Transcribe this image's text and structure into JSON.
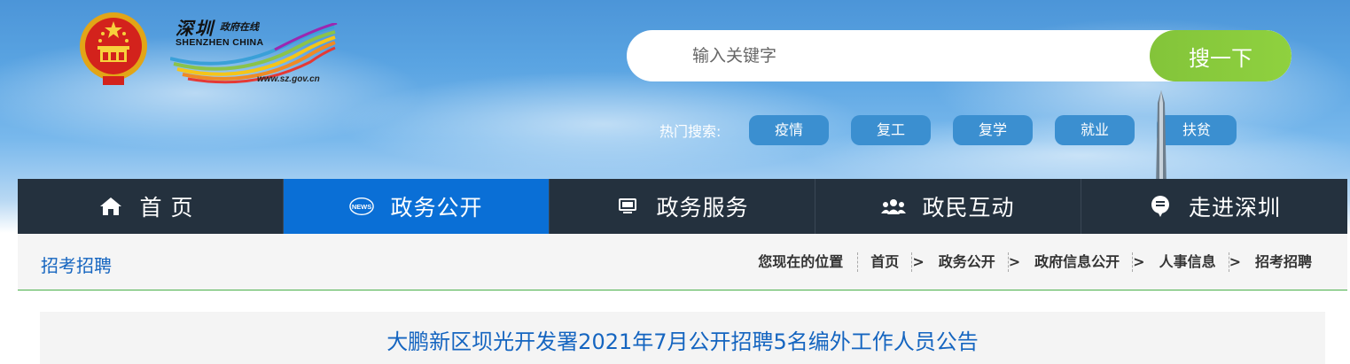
{
  "site": {
    "logo_cn": "深圳",
    "logo_cn_small": "政府在线",
    "logo_en": "SHENZHEN CHINA",
    "logo_url": "www.sz.gov.cn"
  },
  "search": {
    "placeholder": "输入关键字",
    "button_label": "搜一下"
  },
  "hot_search": {
    "label": "热门搜索:",
    "tags": [
      "疫情",
      "复工",
      "复学",
      "就业",
      "扶贫"
    ]
  },
  "nav": {
    "items": [
      {
        "label": "首页",
        "icon": "home-icon"
      },
      {
        "label": "政务公开",
        "icon": "news-icon"
      },
      {
        "label": "政务服务",
        "icon": "monitor-icon"
      },
      {
        "label": "政民互动",
        "icon": "people-icon"
      },
      {
        "label": "走进深圳",
        "icon": "chat-bubble-icon"
      }
    ],
    "active_index": 1
  },
  "breadcrumb": {
    "section_title": "招考招聘",
    "lead": "您现在的位置",
    "separator": ">",
    "items": [
      "首页",
      "政务公开",
      "政府信息公开",
      "人事信息",
      "招考招聘"
    ]
  },
  "article": {
    "title": "大鹏新区坝光开发署2021年7月公开招聘5名编外工作人员公告"
  },
  "colors": {
    "nav_bg": "#24313e",
    "nav_active": "#0a6fd6",
    "search_button": "#8cc63f",
    "hot_tag": "#3b8fd0",
    "title_blue": "#1565c0",
    "divider_green": "#4ab04a"
  }
}
